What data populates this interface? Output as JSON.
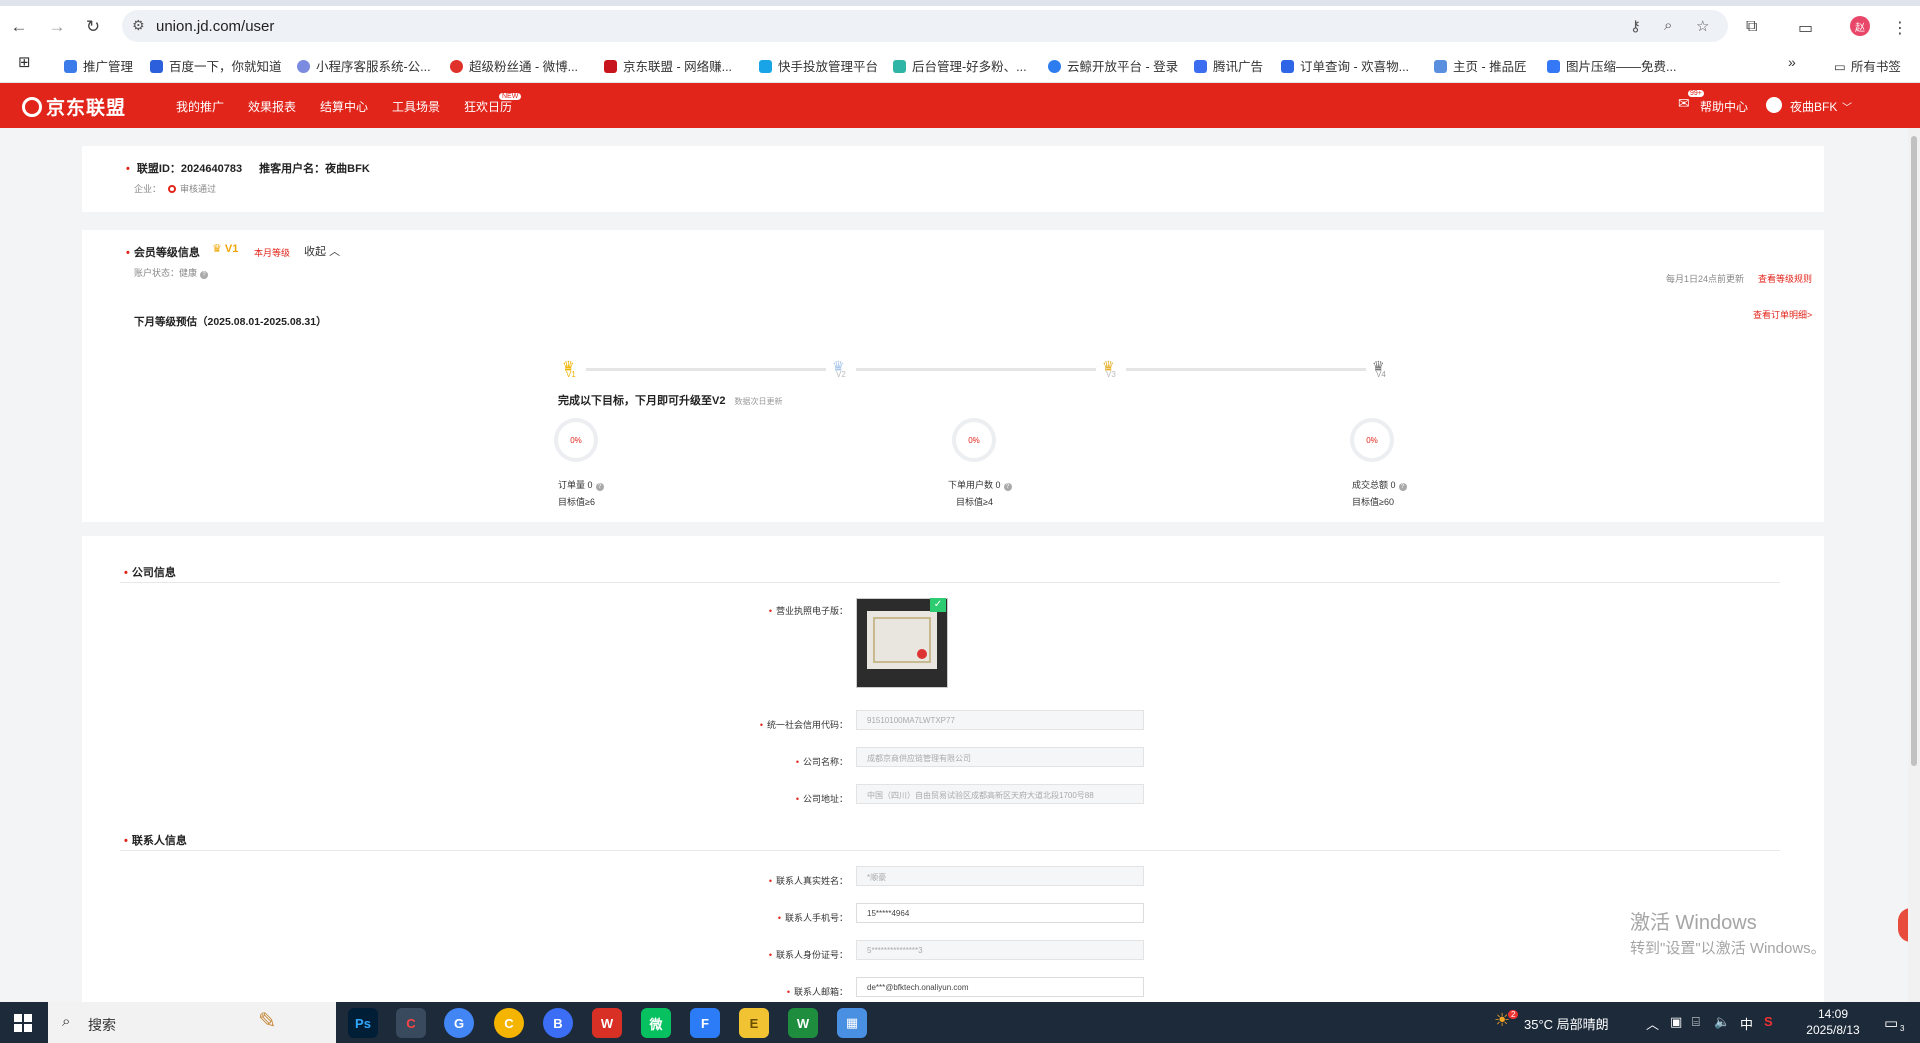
{
  "browser": {
    "url": "union.jd.com/user",
    "bookmarks": [
      "推广管理",
      "百度一下，你就知道",
      "小程序客服系统-公...",
      "超级粉丝通 - 微博...",
      "京东联盟 - 网络赚...",
      "快手投放管理平台",
      "后台管理-好多粉、...",
      "云鲸开放平台 - 登录",
      "腾讯广告",
      "订单查询 - 欢喜物...",
      "主页 - 推品匠",
      "图片压缩——免费..."
    ],
    "all_bookmarks": "所有书签",
    "more_bookmarks": "»",
    "profile_initial": "赵"
  },
  "header": {
    "logo": "京东联盟",
    "nav": [
      "我的推广",
      "效果报表",
      "结算中心",
      "工具场景",
      "狂欢日历"
    ],
    "nav_badge": "NEW",
    "help": "帮助中心",
    "msg_badge": "99+",
    "username": "夜曲BFK"
  },
  "account": {
    "id_label": "联盟ID：",
    "id_value": "2024640783",
    "name_label": "推客用户名：",
    "name_value": "夜曲BFK",
    "company_label": "企业：",
    "company_status": "审核通过"
  },
  "membership": {
    "title": "会员等级信息",
    "level": "V1",
    "level_tag": "本月等级",
    "collapse": "收起",
    "account_status_label": "账户状态：",
    "account_status_value": "健康",
    "update_note": "每月1日24点前更新",
    "rules_link": "查看等级规则",
    "forecast_title": "下月等级预估（2025.08.01-2025.08.31）",
    "orders_link": "查看订单明细>",
    "levels": [
      "V1",
      "V2",
      "V3",
      "V4"
    ],
    "goal_text": "完成以下目标，下月即可升级至V2",
    "goal_note": "数据次日更新",
    "metrics": [
      {
        "label": "订单量 0",
        "target": "目标值≥6",
        "percent": "0%"
      },
      {
        "label": "下单用户数 0",
        "target": "目标值≥4",
        "percent": "0%"
      },
      {
        "label": "成交总额 0",
        "target": "目标值≥60",
        "percent": "0%"
      }
    ]
  },
  "company_info": {
    "title": "公司信息",
    "license_label": "营业执照电子版：",
    "fields": [
      {
        "label": "统一社会信用代码：",
        "value": "91510100MA7LWTXP77"
      },
      {
        "label": "公司名称：",
        "value": "成都京商供应链管理有限公司"
      },
      {
        "label": "公司地址：",
        "value": "中国（四川）自由贸易试验区成都高新区天府大道北段1700号88"
      }
    ]
  },
  "contact_info": {
    "title": "联系人信息",
    "fields": [
      {
        "label": "联系人真实姓名：",
        "value": "*顺豪"
      },
      {
        "label": "联系人手机号：",
        "value": "15*****4964"
      },
      {
        "label": "联系人身份证号：",
        "value": "5***************3"
      },
      {
        "label": "联系人邮箱：",
        "value": "de***@bfktech.onaliyun.com"
      }
    ]
  },
  "windows": {
    "watermark_title": "激活 Windows",
    "watermark_sub": "转到\"设置\"以激活 Windows。",
    "search": "搜索",
    "temp_badge": "2",
    "weather": "35°C 局部晴朗",
    "ime": "中",
    "time": "14:09",
    "date": "2025/8/13",
    "notify_badge": "3",
    "apps": [
      "Ps",
      "C",
      "G",
      "C",
      "B",
      "W",
      "微",
      "F",
      "E",
      "W",
      "▦"
    ]
  },
  "colors": {
    "brand": "#e1251b",
    "taskbar": "#1c2a3a"
  }
}
